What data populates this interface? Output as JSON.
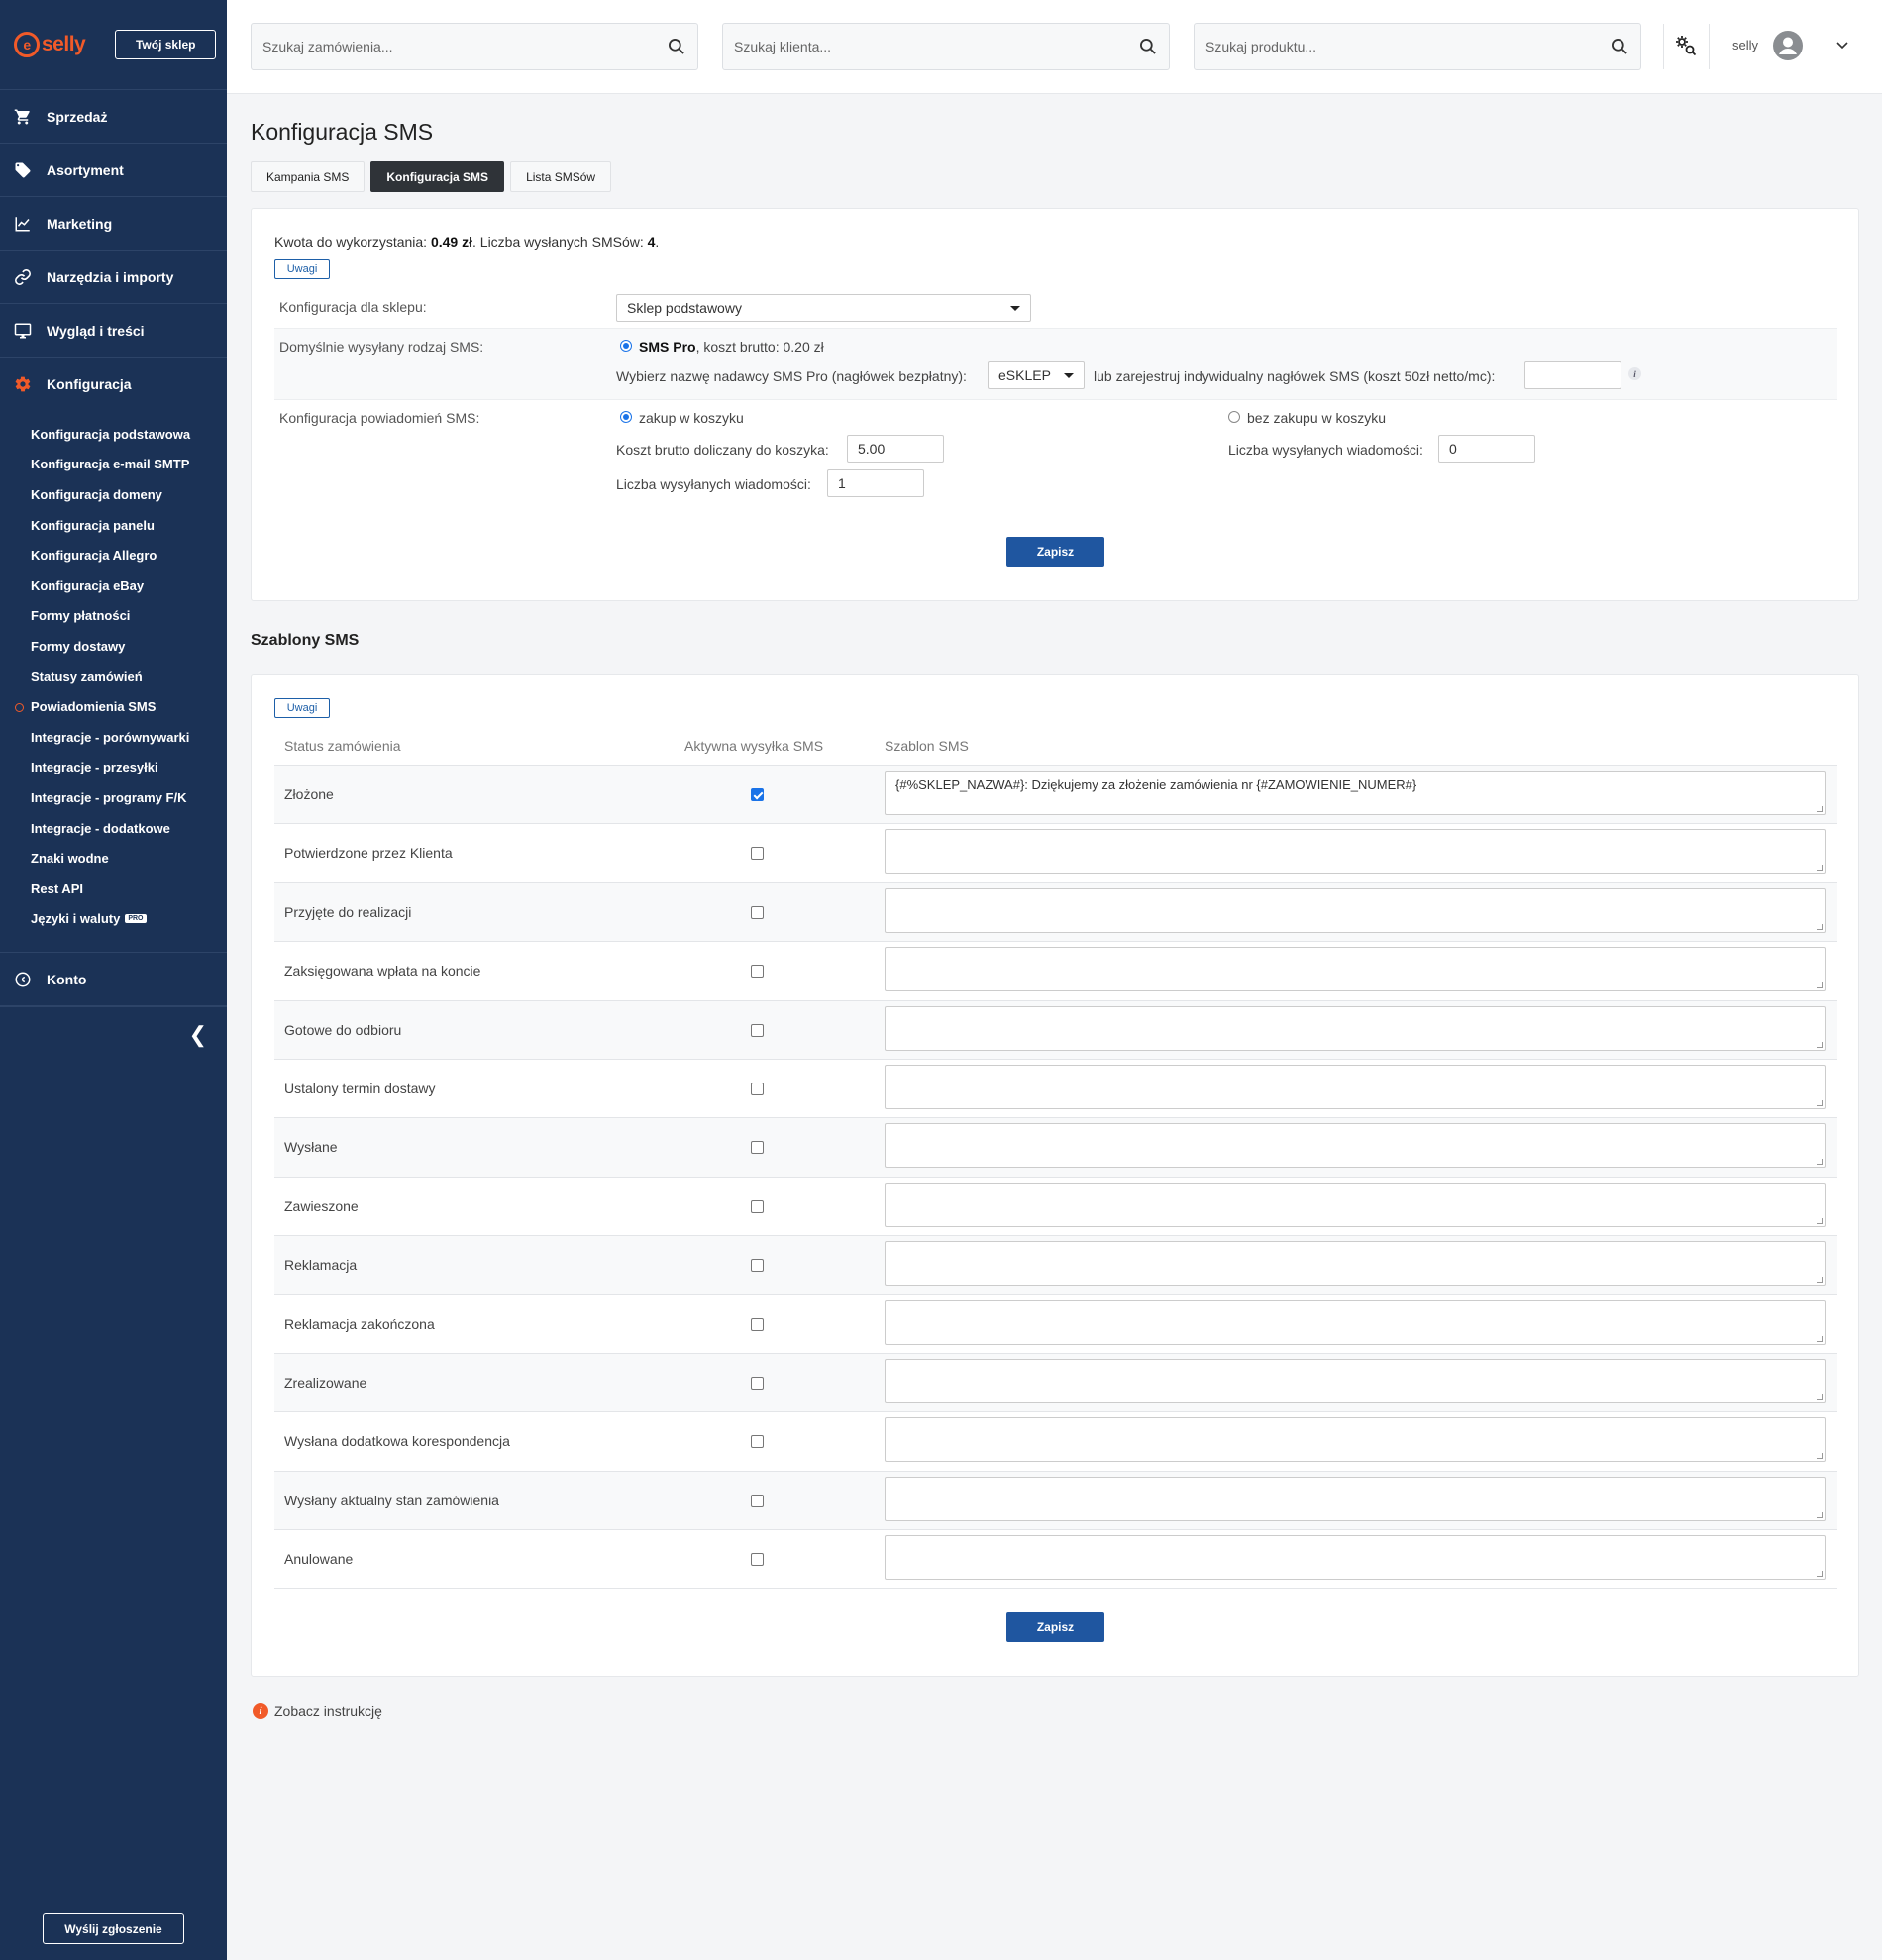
{
  "brand": {
    "logo_mark": "e",
    "logo_text": "selly",
    "shop_button": "Twój sklep",
    "accent": "#f15a29",
    "sidebar_bg": "#1b3256",
    "primary": "#1f56a0"
  },
  "sidebar": {
    "main": [
      {
        "label": "Sprzedaż",
        "icon": "cart-icon"
      },
      {
        "label": "Asortyment",
        "icon": "tag-icon"
      },
      {
        "label": "Marketing",
        "icon": "chart-icon"
      },
      {
        "label": "Narzędzia i importy",
        "icon": "link-icon"
      },
      {
        "label": "Wygląd i treści",
        "icon": "monitor-icon"
      },
      {
        "label": "Konfiguracja",
        "icon": "gear-icon"
      }
    ],
    "sub": [
      "Konfiguracja podstawowa",
      "Konfiguracja e-mail SMTP",
      "Konfiguracja domeny",
      "Konfiguracja panelu",
      "Konfiguracja Allegro",
      "Konfiguracja eBay",
      "Formy płatności",
      "Formy dostawy",
      "Statusy zamówień",
      "Powiadomienia SMS",
      "Integracje - porównywarki",
      "Integracje - przesyłki",
      "Integracje - programy F/K",
      "Integracje - dodatkowe",
      "Znaki wodne",
      "Rest API",
      "Języki i waluty"
    ],
    "pro_badge": "PRO",
    "account": "Konto",
    "collapse": "❮",
    "report_button": "Wyślij zgłoszenie"
  },
  "topbar": {
    "search_orders": "Szukaj zamówienia...",
    "search_clients": "Szukaj klienta...",
    "search_products": "Szukaj produktu...",
    "user": "selly"
  },
  "page": {
    "title": "Konfiguracja SMS",
    "tabs": [
      "Kampania SMS",
      "Konfiguracja SMS",
      "Lista SMSów"
    ]
  },
  "config": {
    "usage_prefix": "Kwota do wykorzystania: ",
    "amount": "0.49 zł",
    "usage_mid": ". Liczba wysłanych SMSów: ",
    "sent_count": "4",
    "usage_suffix": ".",
    "notes_button": "Uwagi",
    "shop_label": "Konfiguracja dla sklepu:",
    "shop_value": "Sklep podstawowy",
    "default_type_label": "Domyślnie wysyłany rodzaj SMS:",
    "sms_pro": "SMS Pro",
    "sms_pro_cost": ", koszt brutto: 0.20 zł",
    "sender_label": "Wybierz nazwę nadawcy SMS Pro (nagłówek bezpłatny):",
    "sender_value": "eSKLEP",
    "register_label": "lub zarejestruj indywidualny nagłówek SMS (koszt 50zł netto/mc):",
    "register_value": "",
    "info": "i",
    "notify_label": "Konfiguracja powiadomień SMS:",
    "opt_purchase": "zakup w koszyku",
    "opt_no_purchase": "bez zakupu w koszyku",
    "cost_label": "Koszt brutto doliczany do koszyka:",
    "cost_value": "5.00",
    "count_label": "Liczba wysyłanych wiadomości:",
    "count_value": "1",
    "count_label_b": "Liczba wysyłanych wiadomości:",
    "count_value_b": "0",
    "save": "Zapisz"
  },
  "templates": {
    "title": "Szablony SMS",
    "notes_button": "Uwagi",
    "headers": [
      "Status zamówienia",
      "Aktywna wysyłka SMS",
      "Szablon SMS"
    ],
    "rows": [
      {
        "status": "Złożone",
        "active": true,
        "template": "{#%SKLEP_NAZWA#}: Dziękujemy za złożenie zamówienia nr {#ZAMOWIENIE_NUMER#}"
      },
      {
        "status": "Potwierdzone przez Klienta",
        "active": false,
        "template": ""
      },
      {
        "status": "Przyjęte do realizacji",
        "active": false,
        "template": ""
      },
      {
        "status": "Zaksięgowana wpłata na koncie",
        "active": false,
        "template": ""
      },
      {
        "status": "Gotowe do odbioru",
        "active": false,
        "template": ""
      },
      {
        "status": "Ustalony termin dostawy",
        "active": false,
        "template": ""
      },
      {
        "status": "Wysłane",
        "active": false,
        "template": ""
      },
      {
        "status": "Zawieszone",
        "active": false,
        "template": ""
      },
      {
        "status": "Reklamacja",
        "active": false,
        "template": ""
      },
      {
        "status": "Reklamacja zakończona",
        "active": false,
        "template": ""
      },
      {
        "status": "Zrealizowane",
        "active": false,
        "template": ""
      },
      {
        "status": "Wysłana dodatkowa korespondencja",
        "active": false,
        "template": ""
      },
      {
        "status": "Wysłany aktualny stan zamówienia",
        "active": false,
        "template": ""
      },
      {
        "status": "Anulowane",
        "active": false,
        "template": ""
      }
    ],
    "save": "Zapisz",
    "instructions_icon": "i",
    "instructions": "Zobacz instrukcję"
  }
}
